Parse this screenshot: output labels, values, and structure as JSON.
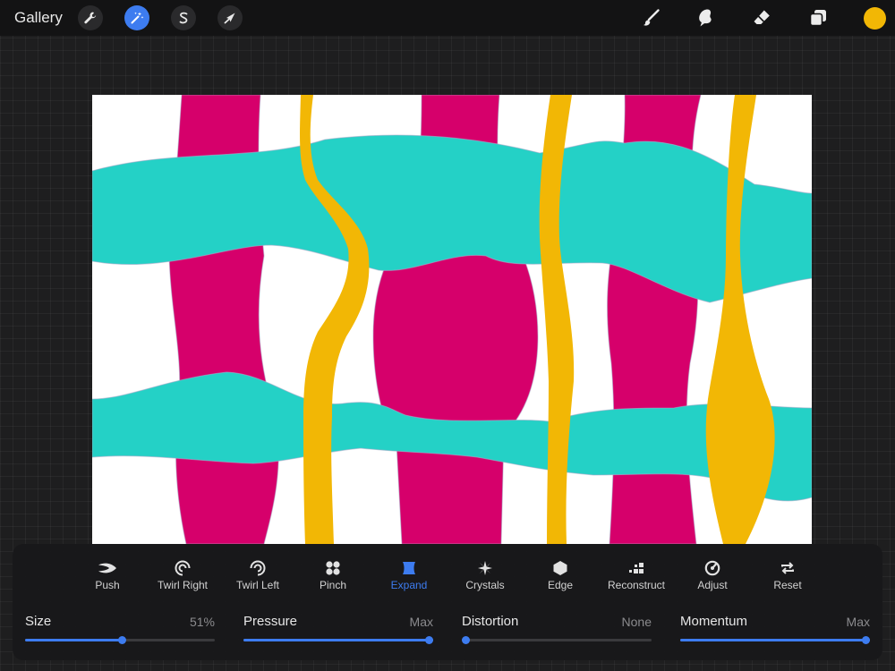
{
  "toolbar": {
    "gallery_label": "Gallery",
    "left_icons": [
      "wrench-icon",
      "magic-wand-icon",
      "selection-s-icon",
      "transform-arrow-icon"
    ],
    "active_icon": "magic-wand-icon",
    "right_tools": [
      "brush-icon",
      "smudge-icon",
      "eraser-icon",
      "layers-icon"
    ],
    "current_color": "#f2b705"
  },
  "artwork": {
    "background": "#ffffff",
    "colors": {
      "magenta": "#d6006b",
      "teal": "#24d1c6",
      "yellow": "#f2b705"
    }
  },
  "liquify": {
    "modes": [
      {
        "label": "Push",
        "icon": "push-icon"
      },
      {
        "label": "Twirl Right",
        "icon": "twirl-right-icon"
      },
      {
        "label": "Twirl Left",
        "icon": "twirl-left-icon"
      },
      {
        "label": "Pinch",
        "icon": "pinch-icon"
      },
      {
        "label": "Expand",
        "icon": "expand-icon"
      },
      {
        "label": "Crystals",
        "icon": "crystals-icon"
      },
      {
        "label": "Edge",
        "icon": "edge-icon"
      },
      {
        "label": "Reconstruct",
        "icon": "reconstruct-icon"
      },
      {
        "label": "Adjust",
        "icon": "adjust-icon"
      },
      {
        "label": "Reset",
        "icon": "reset-icon"
      }
    ],
    "selected_mode": "Expand",
    "accent": "#3d7cf0",
    "sliders": [
      {
        "name": "Size",
        "value": "51%",
        "fraction": 0.51
      },
      {
        "name": "Pressure",
        "value": "Max",
        "fraction": 1.0
      },
      {
        "name": "Distortion",
        "value": "None",
        "fraction": 0.0
      },
      {
        "name": "Momentum",
        "value": "Max",
        "fraction": 1.0
      }
    ]
  }
}
